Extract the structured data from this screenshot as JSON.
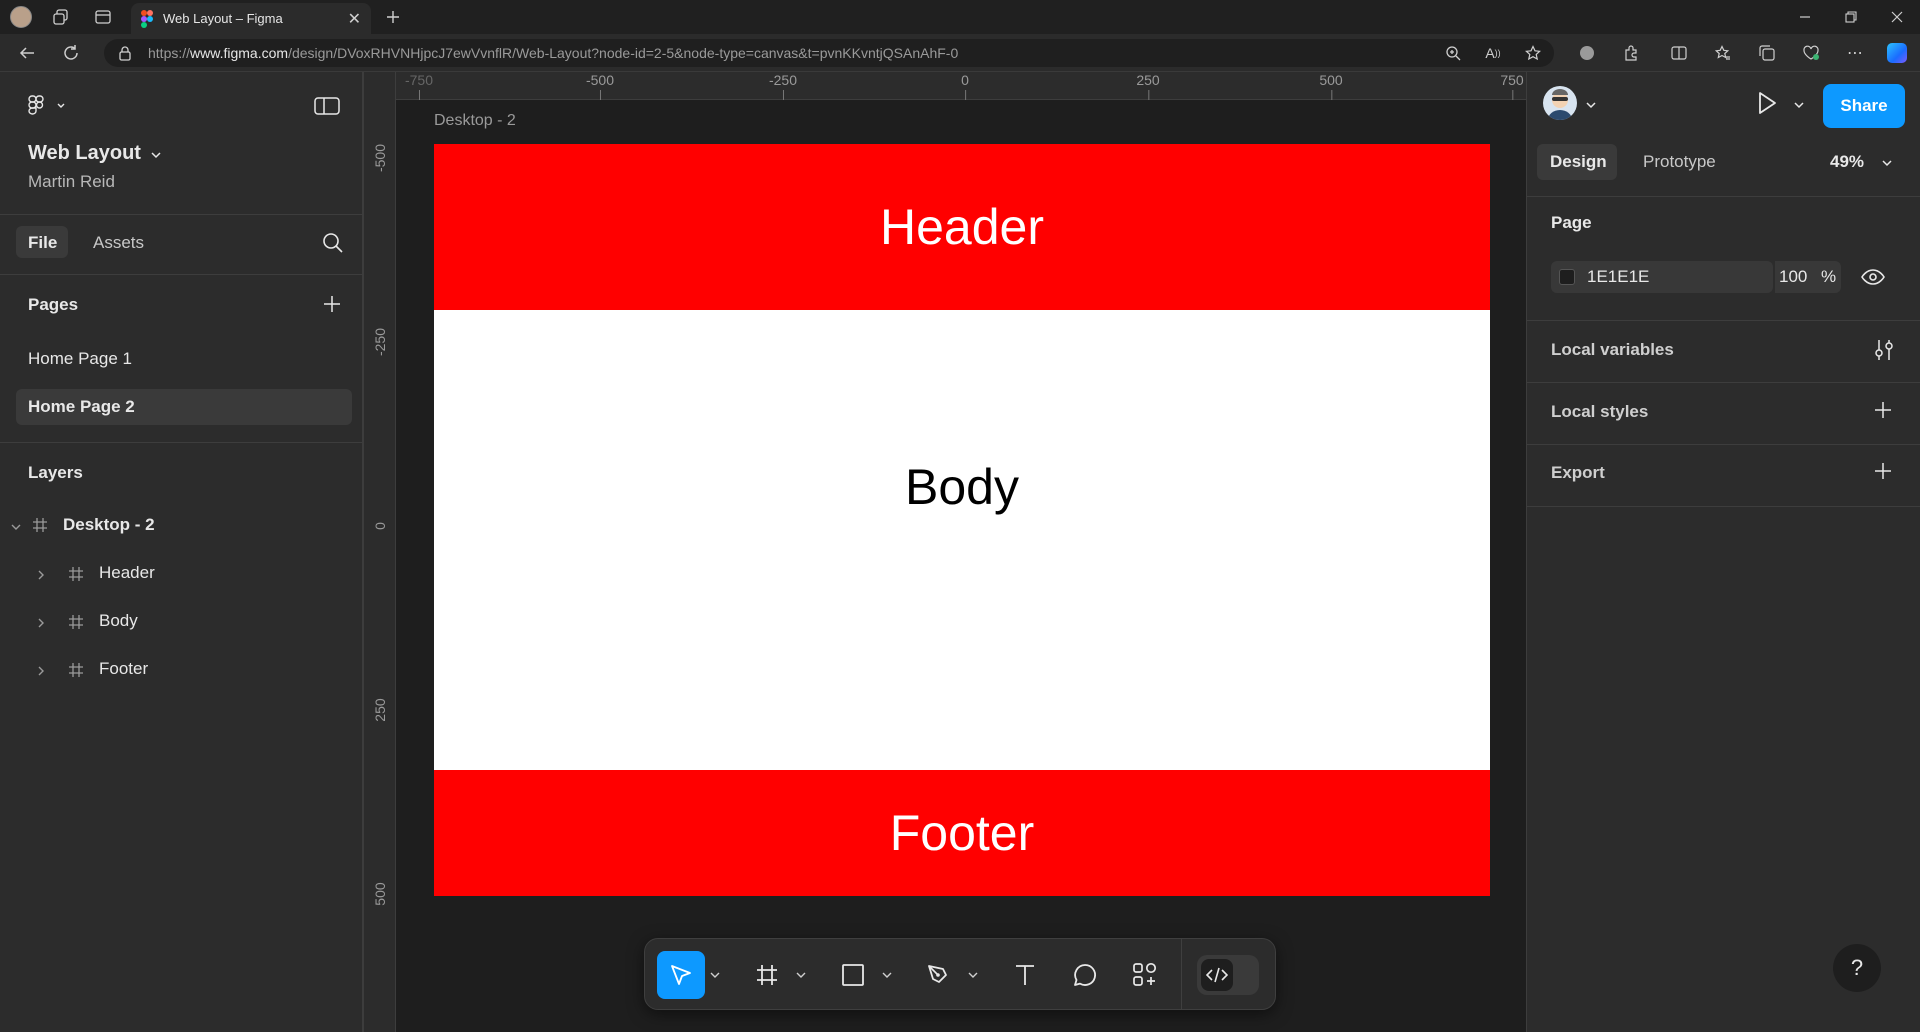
{
  "browser": {
    "tab_title": "Web Layout – Figma",
    "url_prefix": "https://",
    "url_host": "www.figma.com",
    "url_path": "/design/DVoxRHVNHjpcJ7ewVvnflR/Web-Layout?node-id=2-5&node-type=canvas&t=pvnKKvntjQSAnAhF-0"
  },
  "file": {
    "name": "Web Layout",
    "owner": "Martin Reid"
  },
  "left_tabs": {
    "file": "File",
    "assets": "Assets"
  },
  "pages": {
    "heading": "Pages",
    "items": [
      {
        "label": "Home Page 1",
        "selected": false
      },
      {
        "label": "Home Page 2",
        "selected": true
      }
    ]
  },
  "layers": {
    "heading": "Layers",
    "root": "Desktop - 2",
    "children": [
      "Header",
      "Body",
      "Footer"
    ]
  },
  "rulers": {
    "top_ticks": [
      "-750",
      "-500",
      "-250",
      "0",
      "250",
      "500",
      "750"
    ],
    "left_ticks": [
      "-500",
      "-250",
      "0",
      "250",
      "500"
    ]
  },
  "canvas": {
    "frame_label": "Desktop - 2",
    "sections": [
      {
        "label": "Header",
        "bg": "#ff0000",
        "fg": "#ffffff"
      },
      {
        "label": "Body",
        "bg": "#ffffff",
        "fg": "#000000"
      },
      {
        "label": "Footer",
        "bg": "#ff0000",
        "fg": "#ffffff"
      }
    ]
  },
  "right": {
    "share": "Share",
    "tabs": {
      "design": "Design",
      "prototype": "Prototype"
    },
    "zoom": "49%",
    "page_heading": "Page",
    "page_color": "1E1E1E",
    "page_opacity": "100",
    "percent_sign": "%",
    "local_variables": "Local variables",
    "local_styles": "Local styles",
    "export": "Export",
    "help": "?"
  },
  "colors": {
    "accent": "#0d99ff",
    "frame_red": "#ff0000",
    "page_bg": "#1e1e1e"
  }
}
